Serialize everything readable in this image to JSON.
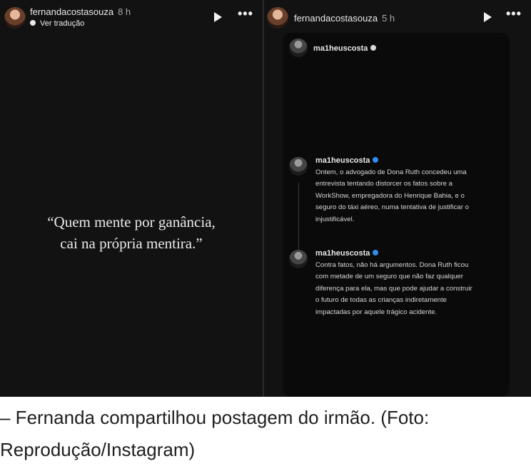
{
  "left_story": {
    "username": "fernandacostasouza",
    "time": "8 h",
    "translate_label": "Ver tradução",
    "quote_line1": "“Quem mente por ganância,",
    "quote_line2": "cai na própria mentira.”"
  },
  "right_story": {
    "username": "fernandacostasouza",
    "time": "5 h",
    "post_user": "ma1heuscosta",
    "comments": [
      {
        "user": "ma1heuscosta",
        "lines": [
          "Ontem, o advogado de Dona Ruth concedeu uma",
          "entrevista tentando distorcer os fatos sobre a",
          "WorkShow, empregadora do Henrique Bahia, e o",
          "seguro do táxi aéreo, numa tentativa de justificar o",
          "injustificável."
        ]
      },
      {
        "user": "ma1heuscosta",
        "lines": [
          "Contra fatos, não há argumentos. Dona Ruth ficou",
          "com metade de um seguro que não faz qualquer",
          "diferença para ela, mas que pode ajudar a construir",
          "o futuro de todas as crianças indiretamente",
          "impactadas por aquele trágico acidente."
        ]
      }
    ]
  },
  "caption": {
    "line1": "– Fernanda compartilhou postagem do irmão. (Foto:",
    "line2": "Reprodução/Instagram)"
  },
  "icons": [
    "avatar",
    "globe-icon",
    "play-icon",
    "more-icon",
    "verified-icon"
  ],
  "colors": {
    "background": "#121212",
    "verified_blue": "#2f8cf0",
    "caption_text": "#1f1f1f"
  }
}
